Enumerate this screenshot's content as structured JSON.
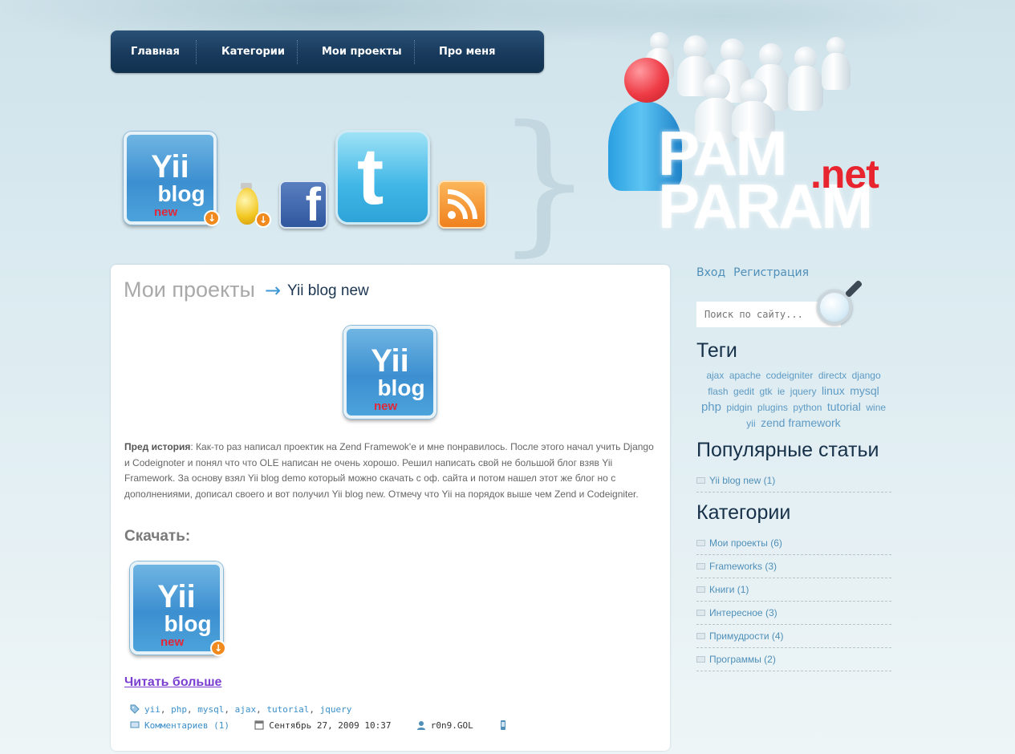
{
  "nav": {
    "items": [
      "Главная",
      "Категории",
      "Мои проекты",
      "Про меня"
    ]
  },
  "header": {
    "logo_line1": "PAM",
    "logo_line2": "PARAM",
    "logo_suffix": ".net",
    "yii_icon": {
      "line1": "Yii",
      "line2": "blog",
      "line3": "new"
    },
    "facebook_letter": "f",
    "twitter_letter": "t",
    "brace": "}"
  },
  "post": {
    "breadcrumb_section": "Мои проекты",
    "breadcrumb_arrow": "→",
    "title": "Yii blog new",
    "body_label": "Пред история",
    "body_text": ": Как-то раз написал проектик на Zend Framewok'е и мне понравилось. После этого начал учить Django и Codeignoter и понял что что OLE написан не очень хорошо. Решил написать свой не большой блог взяв Yii Framework. За основу взял Yii blog demo который можно скачать с оф. сайта и потом нашел этот же блог но с дополнениями, дописал своего и вот получил Yii blog new. Отмечу что Yii на порядок выше чем Zend и Codeigniter.",
    "download_title": "Скачать:",
    "read_more": "Читать больше",
    "tags": [
      "yii",
      "php",
      "mysql",
      "ajax",
      "tutorial",
      "jquery"
    ],
    "comments": "Комментариев (1)",
    "date": "Сентябрь 27, 2009 10:37",
    "author": "r0n9.GOL"
  },
  "sidebar": {
    "login": "Вход",
    "register": "Регистрация",
    "search_placeholder": "Поиск по сайту...",
    "tags_title": "Теги",
    "tags": [
      {
        "label": "ajax",
        "size": 12
      },
      {
        "label": "apache",
        "size": 12
      },
      {
        "label": "codeigniter",
        "size": 12
      },
      {
        "label": "directx",
        "size": 12
      },
      {
        "label": "django",
        "size": 12
      },
      {
        "label": "flash",
        "size": 12
      },
      {
        "label": "gedit",
        "size": 12
      },
      {
        "label": "gtk",
        "size": 12
      },
      {
        "label": "ie",
        "size": 12
      },
      {
        "label": "jquery",
        "size": 12
      },
      {
        "label": "linux",
        "size": 14
      },
      {
        "label": "mysql",
        "size": 14
      },
      {
        "label": "php",
        "size": 15
      },
      {
        "label": "pidgin",
        "size": 12
      },
      {
        "label": "plugins",
        "size": 12
      },
      {
        "label": "python",
        "size": 12
      },
      {
        "label": "tutorial",
        "size": 14
      },
      {
        "label": "wine",
        "size": 12
      },
      {
        "label": "yii",
        "size": 12
      },
      {
        "label": "zend framework",
        "size": 14
      }
    ],
    "popular_title": "Популярные статьи",
    "popular": [
      "Yii blog new (1)"
    ],
    "categories_title": "Категории",
    "categories": [
      "Мои проекты (6)",
      "Frameworks (3)",
      "Книги (1)",
      "Интересное (3)",
      "Примудрости (4)",
      "Программы (2)"
    ]
  }
}
